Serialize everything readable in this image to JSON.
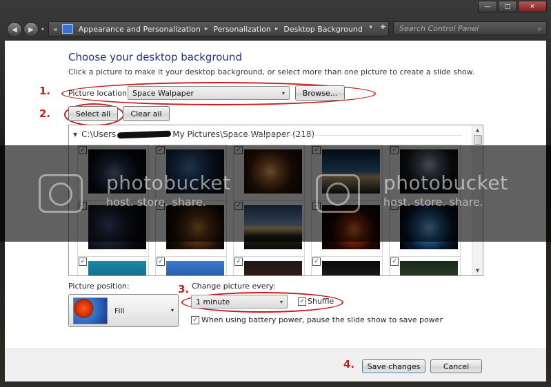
{
  "window": {
    "minimize": "—",
    "maximize": "□",
    "close": "✕"
  },
  "nav": {
    "back": "◀",
    "forward": "▶",
    "dropdown": "▾"
  },
  "address": {
    "overflow": "«",
    "crumbs": [
      "Appearance and Personalization",
      "Personalization",
      "Desktop Background"
    ],
    "separator": "▸",
    "dropdown": "▾",
    "refresh": "✚"
  },
  "search": {
    "placeholder": "Search Control Panel",
    "icon": "⌕"
  },
  "page": {
    "title": "Choose your desktop background",
    "subtitle": "Click a picture to make it your desktop background, or select more than one picture to create a slide show."
  },
  "location": {
    "label": "Picture location:",
    "value": "Space Walpaper",
    "arrow": "▾",
    "browse": "Browse..."
  },
  "selection": {
    "select_all": "Select all",
    "clear_all": "Clear all"
  },
  "steps": [
    "1.",
    "2.",
    "3.",
    "4."
  ],
  "gallery": {
    "folder_prefix": "C:\\Users",
    "folder_suffix": "My Pictures\\Space Walpaper (218)",
    "collapse": "▼",
    "check": "✓",
    "scroll_up": "▲",
    "scroll_down": "▼"
  },
  "watermark": {
    "brand": "photobucket",
    "tagline": "host. store. share."
  },
  "position": {
    "label": "Picture position:",
    "value": "Fill",
    "arrow": "▾"
  },
  "interval": {
    "label": "Change picture every:",
    "value": "1 minute",
    "arrow": "▾",
    "shuffle": "Shuffle",
    "shuffle_checked": "✓",
    "battery": "When using battery power, pause the slide show to save power",
    "battery_checked": "✓"
  },
  "footer": {
    "save": "Save changes",
    "cancel": "Cancel"
  }
}
